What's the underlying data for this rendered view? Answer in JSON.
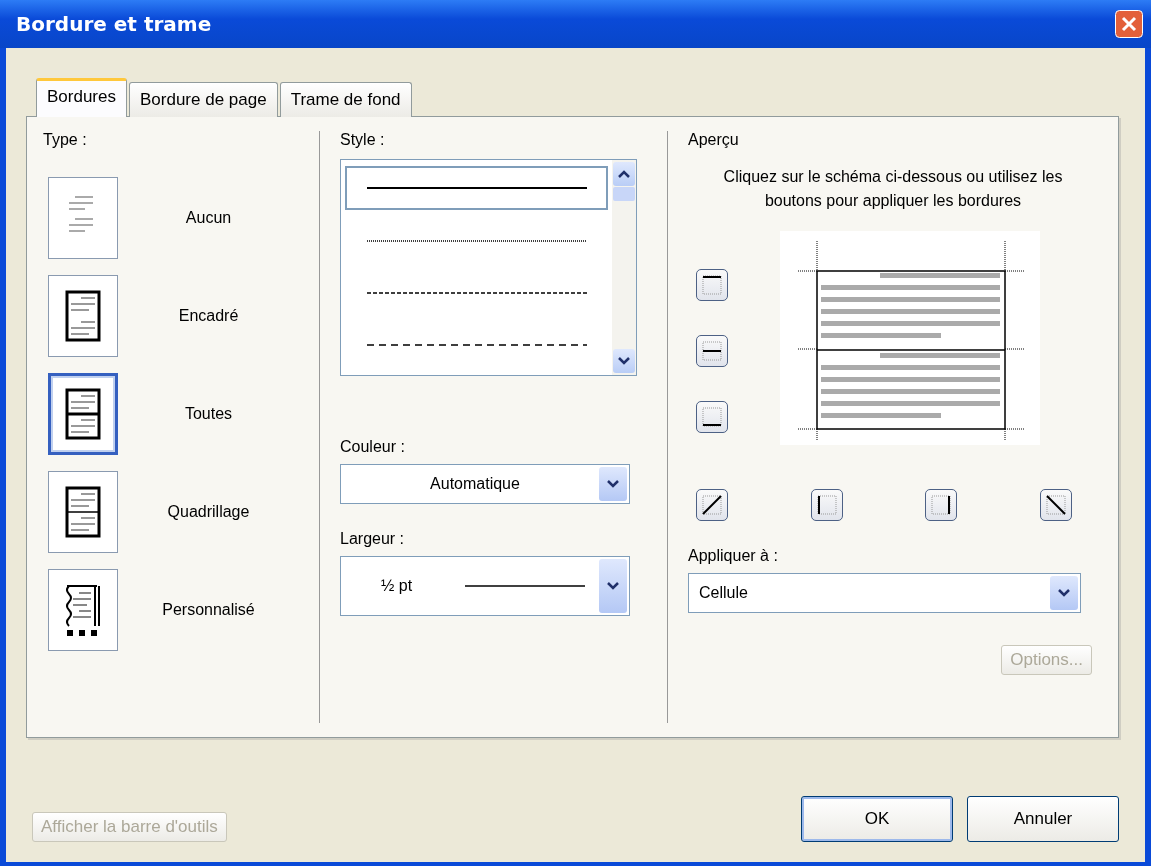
{
  "window": {
    "title": "Bordure et trame"
  },
  "tabs": [
    {
      "label": "Bordures",
      "selected": true
    },
    {
      "label": "Bordure de page",
      "selected": false
    },
    {
      "label": "Trame de fond",
      "selected": false
    }
  ],
  "type": {
    "label": "Type :",
    "options": [
      {
        "kind": "none",
        "label": "Aucun",
        "selected": false
      },
      {
        "kind": "box",
        "label": "Encadré",
        "selected": false
      },
      {
        "kind": "all",
        "label": "Toutes",
        "selected": true
      },
      {
        "kind": "grid",
        "label": "Quadrillage",
        "selected": false
      },
      {
        "kind": "custom",
        "label": "Personnalisé",
        "selected": false
      }
    ]
  },
  "style": {
    "label": "Style :",
    "items": [
      {
        "kind": "solid",
        "selected": true
      },
      {
        "kind": "dotted",
        "selected": false
      },
      {
        "kind": "dashed",
        "selected": false
      },
      {
        "kind": "longdash",
        "selected": false
      }
    ]
  },
  "color": {
    "label": "Couleur :",
    "value": "Automatique"
  },
  "width": {
    "label": "Largeur :",
    "value": "½ pt"
  },
  "preview": {
    "label": "Aperçu",
    "instruction": "Cliquez sur le schéma ci-dessous ou utilisez les boutons pour appliquer les bordures",
    "side_buttons": [
      {
        "kind": "top"
      },
      {
        "kind": "middle"
      },
      {
        "kind": "bottom"
      }
    ],
    "bottom_buttons": [
      {
        "kind": "diag-up"
      },
      {
        "kind": "left"
      },
      {
        "kind": "right"
      },
      {
        "kind": "diag-down"
      }
    ]
  },
  "apply_to": {
    "label": "Appliquer à :",
    "value": "Cellule"
  },
  "options_button": {
    "label": "Options...",
    "disabled": true
  },
  "toolbar_button": {
    "label": "Afficher la barre d'outils",
    "disabled": true
  },
  "buttons": [
    {
      "label": "OK",
      "default": true
    },
    {
      "label": "Annuler",
      "default": false
    }
  ]
}
